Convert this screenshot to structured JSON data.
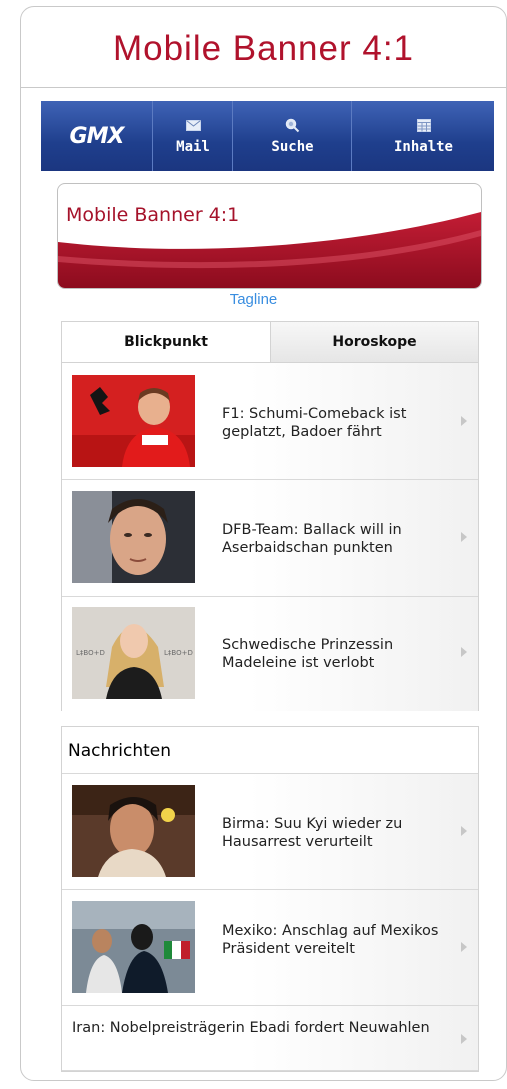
{
  "page_title": "Mobile Banner 4:1",
  "nav": {
    "logo": "GMX",
    "items": [
      {
        "label": "Mail",
        "icon": "envelope-icon"
      },
      {
        "label": "Suche",
        "icon": "magnifier-icon"
      },
      {
        "label": "Inhalte",
        "icon": "grid-icon"
      }
    ]
  },
  "banner": {
    "text": "Mobile Banner 4:1"
  },
  "tagline": "Tagline",
  "tabs": [
    {
      "label": "Blickpunkt",
      "active": true
    },
    {
      "label": "Horoskope",
      "active": false
    }
  ],
  "blickpunkt": [
    {
      "text": "F1: Schumi-Comeback ist geplatzt, Badoer fährt"
    },
    {
      "text": "DFB-Team: Ballack will in Aserbaidschan punkten"
    },
    {
      "text": "Schwedische Prinzessin Madeleine ist verlobt"
    }
  ],
  "nachrichten": {
    "title": "Nachrichten",
    "items": [
      {
        "text": "Birma: Suu Kyi wieder zu Hausarrest verurteilt"
      },
      {
        "text": "Mexiko: Anschlag auf Mexikos Präsident vereitelt"
      },
      {
        "text": "Iran: Nobelpreisträgerin Ebadi fordert Neuwahlen"
      }
    ]
  },
  "colors": {
    "title_red": "#b0122c",
    "nav_blue": "#1f3f8d",
    "tagline_blue": "#3a8ee0"
  }
}
